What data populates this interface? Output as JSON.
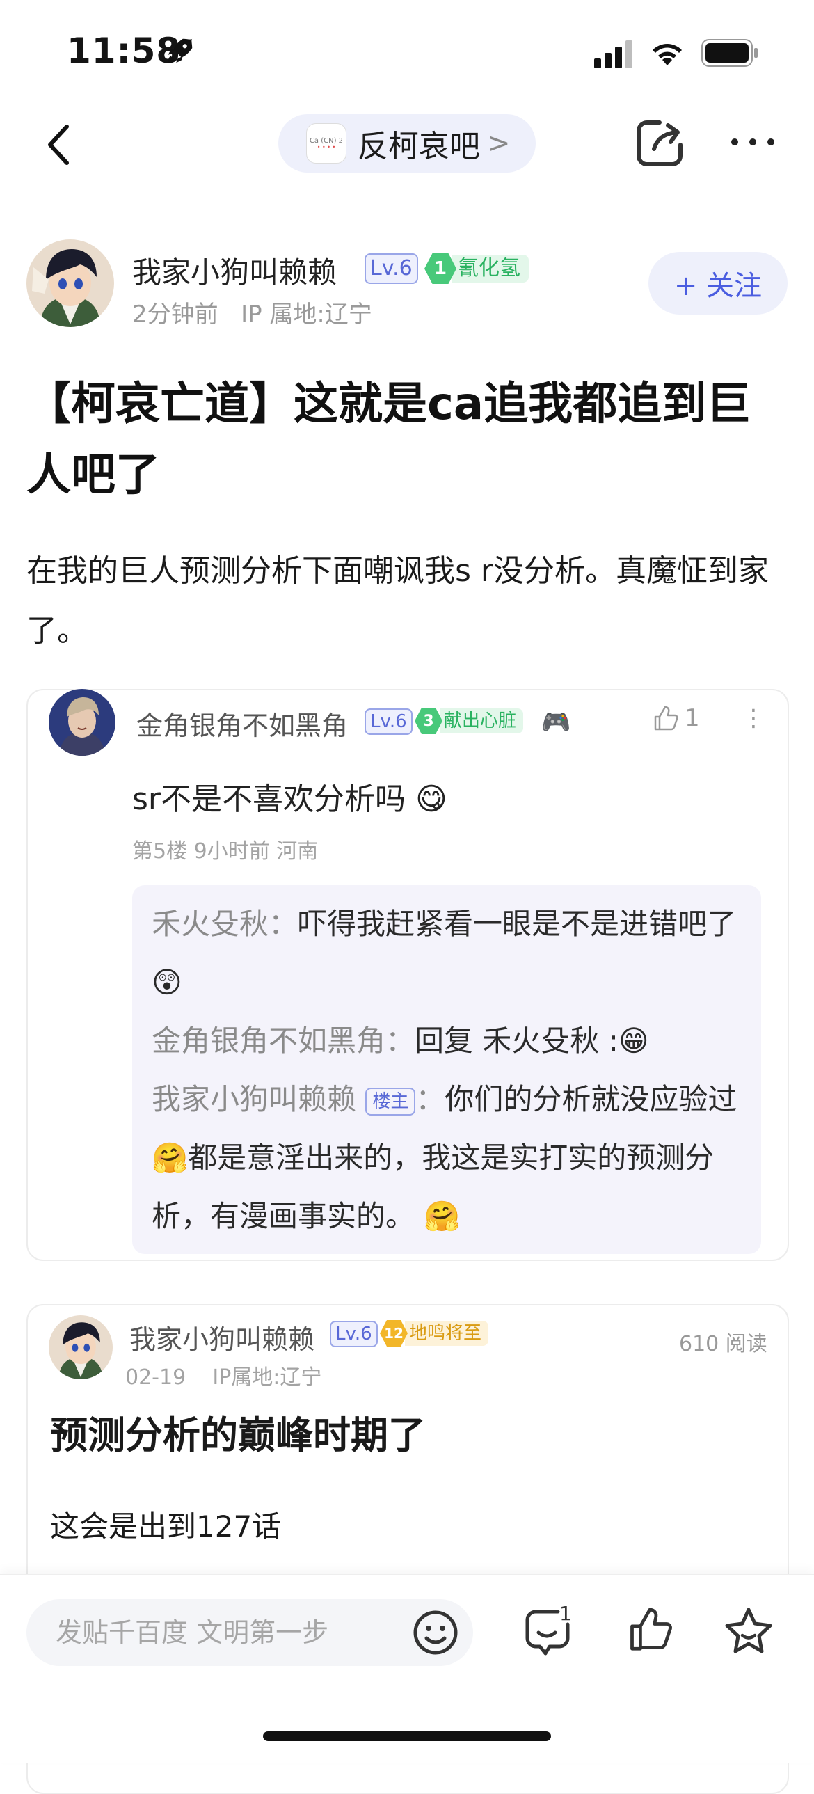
{
  "status_bar": {
    "time": "11:58"
  },
  "nav": {
    "forum_logo_text": "Ca (CN) 2",
    "forum_name": "反柯哀吧",
    "forum_chevron": ">"
  },
  "author": {
    "name": "我家小狗叫赖赖",
    "level": "Lv.6",
    "honor_level": "1",
    "honor_title": "氰化氢",
    "time": "2分钟前",
    "ip": "IP 属地:辽宁",
    "follow_label": "+ 关注"
  },
  "post": {
    "title": "【柯哀亡道】这就是ca追我都追到巨人吧了",
    "body": "在我的巨人预测分析下面嘲讽我s r没分析。真魔怔到家了。"
  },
  "screenshot_comment": {
    "user": "金角银角不如黑角",
    "level": "Lv.6",
    "honor_level": "3",
    "honor_title": "献出心脏",
    "extra_emoji": "🎮",
    "likes": "1",
    "text": "sr不是不喜欢分析吗 😋",
    "meta": "第5楼  9小时前  河南",
    "replies": [
      {
        "user": "禾火殳秋",
        "text": "吓得我赶紧看一眼是不是进错吧了 😲"
      },
      {
        "user": "金角银角不如黑角",
        "text": "回复 禾火殳秋 :😁"
      },
      {
        "user": "我家小狗叫赖赖",
        "tag": "楼主",
        "text": "你们的分析就没应验过 🤗都是意淫出来的，我这是实打实的预测分析，有漫画事实的。 🤗"
      }
    ]
  },
  "screenshot_post": {
    "user": "我家小狗叫赖赖",
    "level": "Lv.6",
    "honor_level": "12",
    "honor_title": "地鸣将至",
    "reads": "610 阅读",
    "date": "02-19",
    "ip": "IP属地:辽宁",
    "title": "预测分析的巅峰时期了",
    "body": "这会是出到127话"
  },
  "bottom": {
    "placeholder": "发贴千百度 文明第一步",
    "comment_count": "1"
  }
}
